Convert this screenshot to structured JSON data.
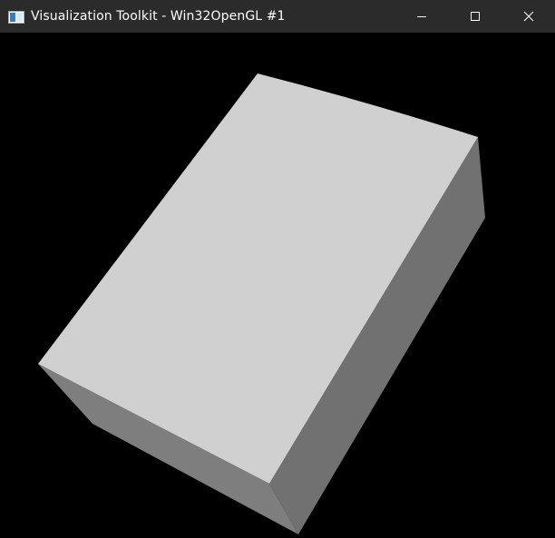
{
  "window": {
    "title": "Visualization Toolkit - Win32OpenGL #1",
    "app_icon": "vtk-window-icon",
    "controls": [
      {
        "name": "minimize",
        "icon": "minimize-icon"
      },
      {
        "name": "maximize",
        "icon": "maximize-icon"
      },
      {
        "name": "close",
        "icon": "close-icon"
      }
    ]
  },
  "scene": {
    "background_color": "#000000",
    "object": "cube",
    "faces": {
      "top": "#d0d0d0",
      "right": "#717171",
      "left": "#7e7e7e"
    }
  },
  "colors": {
    "titlebar_bg": "#2b2b2b",
    "titlebar_text": "#ffffff"
  }
}
